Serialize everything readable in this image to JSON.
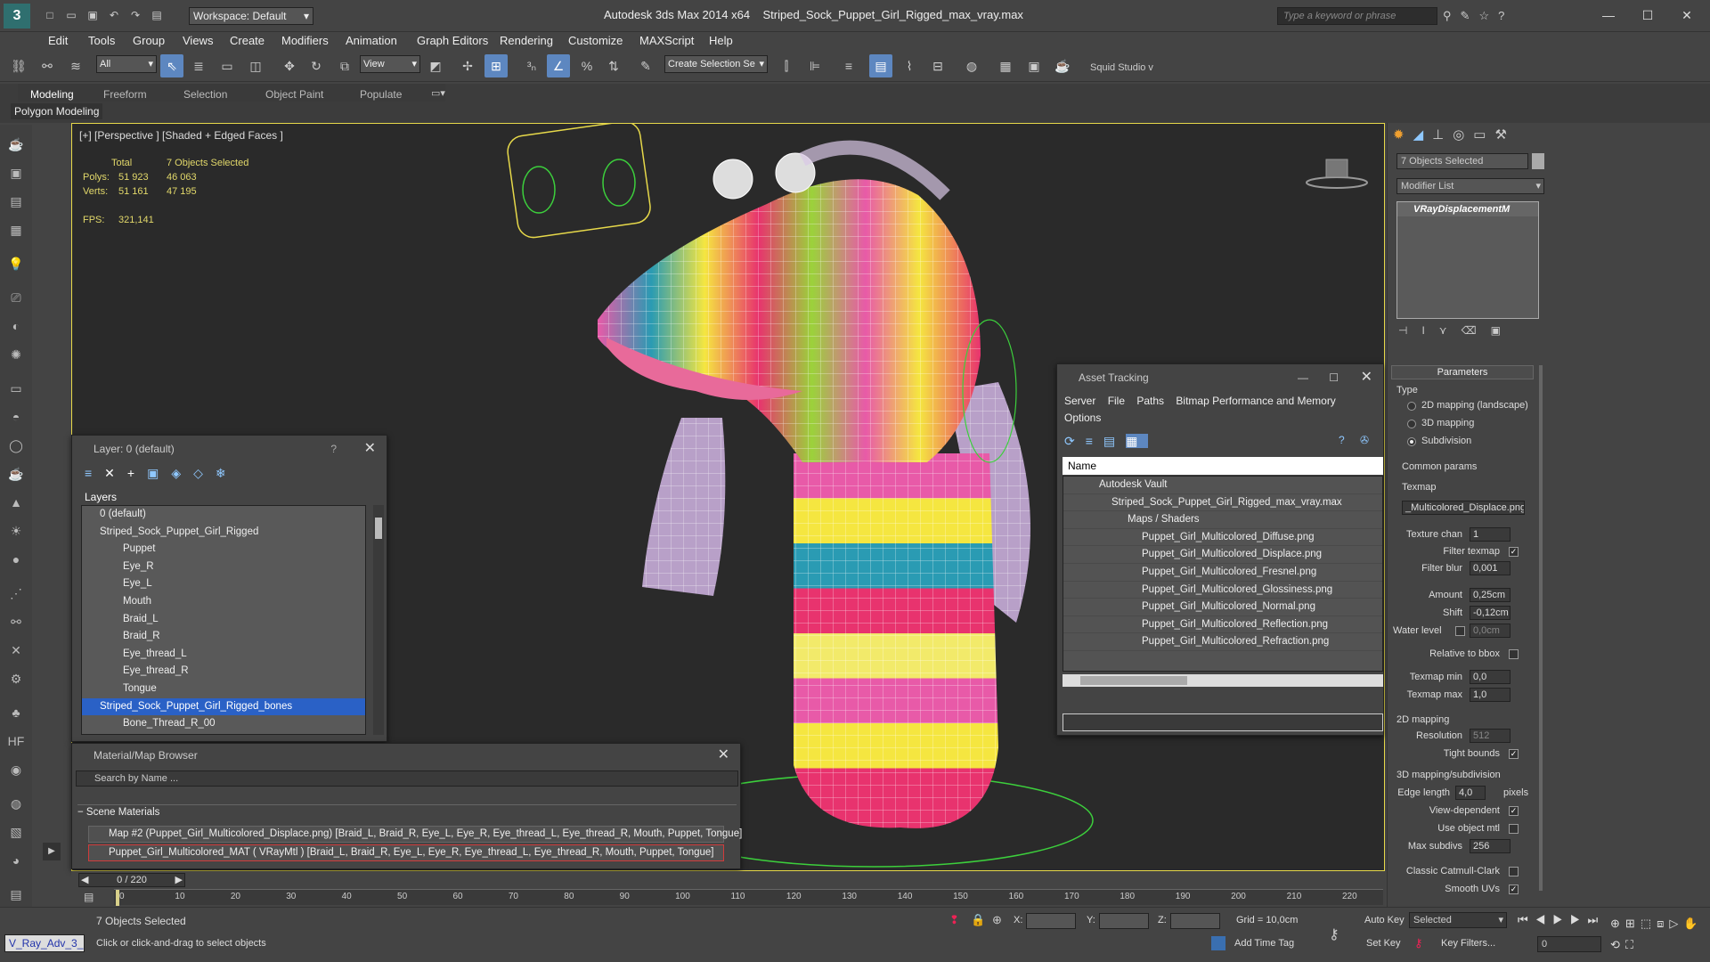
{
  "app": {
    "title": "Autodesk 3ds Max  2014 x64",
    "file": "Striped_Sock_Puppet_Girl_Rigged_max_vray.max",
    "workspace": "Workspace: Default",
    "search_placeholder": "Type a keyword or phrase"
  },
  "menu": [
    "Edit",
    "Tools",
    "Group",
    "Views",
    "Create",
    "Modifiers",
    "Animation",
    "Graph Editors",
    "Rendering",
    "Customize",
    "MAXScript",
    "Help"
  ],
  "toolbar": {
    "filter": "All",
    "coord": "View",
    "selection_set": "Create Selection Se",
    "studio": "Squid Studio v"
  },
  "ribbon": {
    "tabs": [
      "Modeling",
      "Freeform",
      "Selection",
      "Object Paint",
      "Populate"
    ],
    "sub": "Polygon Modeling"
  },
  "viewport": {
    "label": "[+] [Perspective ] [Shaded + Edged Faces ]",
    "stats": {
      "total_label": "Total",
      "selected_label": "7 Objects Selected",
      "polys_label": "Polys:",
      "polys_total": "51 923",
      "polys_sel": "46 063",
      "verts_label": "Verts:",
      "verts_total": "51 161",
      "verts_sel": "47 195",
      "fps_label": "FPS:",
      "fps": "321,141"
    }
  },
  "layers": {
    "title": "Layer: 0 (default)",
    "help": "?",
    "header": "Layers",
    "rows": [
      "0 (default)",
      "Striped_Sock_Puppet_Girl_Rigged",
      "Puppet",
      "Eye_R",
      "Eye_L",
      "Mouth",
      "Braid_L",
      "Braid_R",
      "Eye_thread_L",
      "Eye_thread_R",
      "Tongue",
      "Striped_Sock_Puppet_Girl_Rigged_bones",
      "Bone_Thread_R_00"
    ]
  },
  "material_browser": {
    "title": "Material/Map Browser",
    "search": "Search by Name ...",
    "section": "Scene Materials",
    "items": [
      "Map #2 (Puppet_Girl_Multicolored_Displace.png) [Braid_L, Braid_R, Eye_L, Eye_R, Eye_thread_L, Eye_thread_R, Mouth, Puppet, Tongue]",
      "Puppet_Girl_Multicolored_MAT ( VRayMtl ) [Braid_L, Braid_R, Eye_L, Eye_R, Eye_thread_L, Eye_thread_R, Mouth, Puppet, Tongue]"
    ]
  },
  "asset_tracking": {
    "title": "Asset Tracking",
    "menu": [
      "Server",
      "File",
      "Paths",
      "Bitmap Performance and Memory",
      "Options"
    ],
    "col": "Name",
    "rows": [
      "Autodesk Vault",
      "Striped_Sock_Puppet_Girl_Rigged_max_vray.max",
      "Maps / Shaders",
      "Puppet_Girl_Multicolored_Diffuse.png",
      "Puppet_Girl_Multicolored_Displace.png",
      "Puppet_Girl_Multicolored_Fresnel.png",
      "Puppet_Girl_Multicolored_Glossiness.png",
      "Puppet_Girl_Multicolored_Normal.png",
      "Puppet_Girl_Multicolored_Reflection.png",
      "Puppet_Girl_Multicolored_Refraction.png"
    ]
  },
  "command_panel": {
    "selected": "7 Objects Selected",
    "modifier_list": "Modifier List",
    "modifier": "VRayDisplacementM",
    "params_title": "Parameters",
    "type_label": "Type",
    "types": [
      "2D mapping (landscape)",
      "3D mapping",
      "Subdivision"
    ],
    "common": "Common params",
    "texmap_label": "Texmap",
    "texmap": "_Multicolored_Displace.png)",
    "texture_chan_label": "Texture chan",
    "texture_chan": "1",
    "filter_texmap": "Filter texmap",
    "filter_blur_label": "Filter blur",
    "filter_blur": "0,001",
    "amount_label": "Amount",
    "amount": "0,25cm",
    "shift_label": "Shift",
    "shift": "-0,12cm",
    "water_label": "Water level",
    "water": "0,0cm",
    "relative": "Relative to bbox",
    "texmap_min_label": "Texmap min",
    "texmap_min": "0,0",
    "texmap_max_label": "Texmap max",
    "texmap_max": "1,0",
    "map2d": "2D mapping",
    "resolution_label": "Resolution",
    "resolution": "512",
    "tight": "Tight bounds",
    "map3d": "3D mapping/subdivision",
    "edge_label": "Edge length",
    "edge": "4,0",
    "pixels": "pixels",
    "view_dep": "View-dependent",
    "use_obj": "Use object mtl",
    "max_subdiv_label": "Max subdivs",
    "max_subdiv": "256",
    "catmull": "Classic Catmull-Clark",
    "smooth": "Smooth UVs"
  },
  "timeline": {
    "frame": "0 / 220",
    "ticks": [
      "0",
      "10",
      "20",
      "30",
      "40",
      "50",
      "60",
      "70",
      "80",
      "90",
      "100",
      "110",
      "120",
      "130",
      "140",
      "150",
      "160",
      "170",
      "180",
      "190",
      "200",
      "210",
      "220"
    ]
  },
  "status": {
    "selected": "7 Objects Selected",
    "hint": "Click or click-and-drag to select objects",
    "x_label": "X:",
    "y_label": "Y:",
    "z_label": "Z:",
    "grid": "Grid = 10,0cm",
    "add_time_tag": "Add Time Tag",
    "auto_key": "Auto Key",
    "set_key": "Set Key",
    "key_mode": "Selected",
    "key_filters": "Key Filters...",
    "frame_field": "0",
    "script_tab": "V_Ray_Adv_3_"
  }
}
